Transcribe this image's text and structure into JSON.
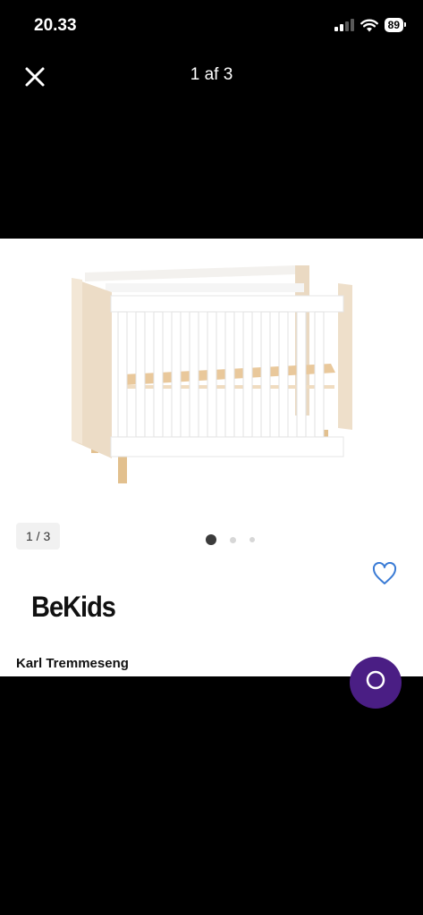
{
  "status": {
    "time": "20.33",
    "battery": "89"
  },
  "viewer": {
    "counter": "1 af 3",
    "page_chip": "1 / 3",
    "total_images": 3,
    "current_index": 1
  },
  "product": {
    "brand": "BeKids",
    "title": "Karl Tremmeseng"
  },
  "icons": {
    "close": "close-icon",
    "favorite": "heart-icon",
    "chat": "chat-icon"
  },
  "colors": {
    "background": "#000000",
    "favorite": "#3a7bd5",
    "chat_button": "#4a1e84"
  }
}
